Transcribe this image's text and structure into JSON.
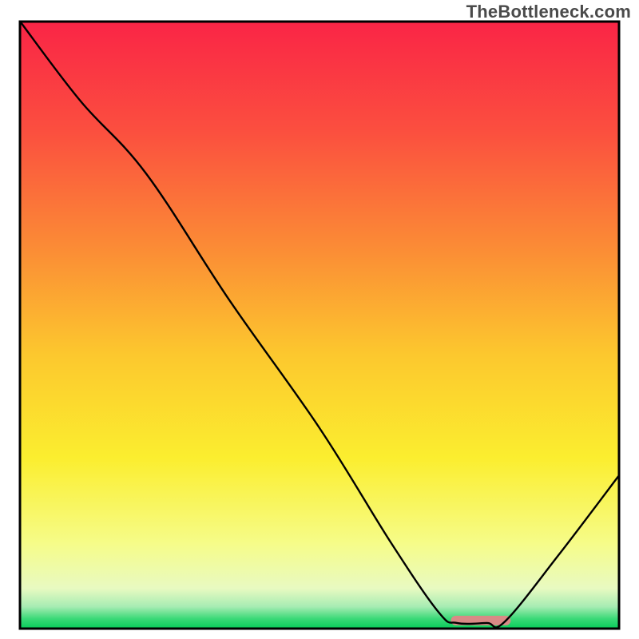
{
  "watermark": "TheBottleneck.com",
  "chart_data": {
    "type": "line",
    "note": "No axes, ticks, or numeric labels are visible. Values below are normalized to the 0-100 range for both axes based on pixel position within the inner plot area (x left→right, y bottom→top). Curve shape: steep descent from top-left, inflection ~x=21, near-linear drop, flat valley around x≈73-81, rise to right edge.",
    "xlim": [
      0,
      100
    ],
    "ylim": [
      0,
      100
    ],
    "series": [
      {
        "name": "bottleneck-curve",
        "points": [
          {
            "x": 0.0,
            "y": 100.0
          },
          {
            "x": 10.0,
            "y": 87.0
          },
          {
            "x": 21.0,
            "y": 75.0
          },
          {
            "x": 35.0,
            "y": 54.0
          },
          {
            "x": 50.0,
            "y": 33.0
          },
          {
            "x": 62.0,
            "y": 14.0
          },
          {
            "x": 70.0,
            "y": 2.5
          },
          {
            "x": 73.0,
            "y": 0.8
          },
          {
            "x": 78.0,
            "y": 0.8
          },
          {
            "x": 81.0,
            "y": 1.0
          },
          {
            "x": 90.0,
            "y": 12.0
          },
          {
            "x": 100.0,
            "y": 25.0
          }
        ]
      }
    ],
    "marker": {
      "name": "optimal-range-bar",
      "x_start": 72.0,
      "x_end": 82.0,
      "y": 1.2,
      "color": "#d98a86"
    },
    "background": {
      "type": "vertical-gradient",
      "stops": [
        {
          "pos": 0.0,
          "color": "#fa2546"
        },
        {
          "pos": 0.18,
          "color": "#fb4f3f"
        },
        {
          "pos": 0.38,
          "color": "#fb8e35"
        },
        {
          "pos": 0.55,
          "color": "#fcc82e"
        },
        {
          "pos": 0.72,
          "color": "#fbee2f"
        },
        {
          "pos": 0.86,
          "color": "#f6fc88"
        },
        {
          "pos": 0.935,
          "color": "#e8fac1"
        },
        {
          "pos": 0.965,
          "color": "#a7ecb3"
        },
        {
          "pos": 0.985,
          "color": "#3ad977"
        },
        {
          "pos": 1.0,
          "color": "#0bcd5c"
        }
      ]
    },
    "frame_color": "#000000"
  }
}
